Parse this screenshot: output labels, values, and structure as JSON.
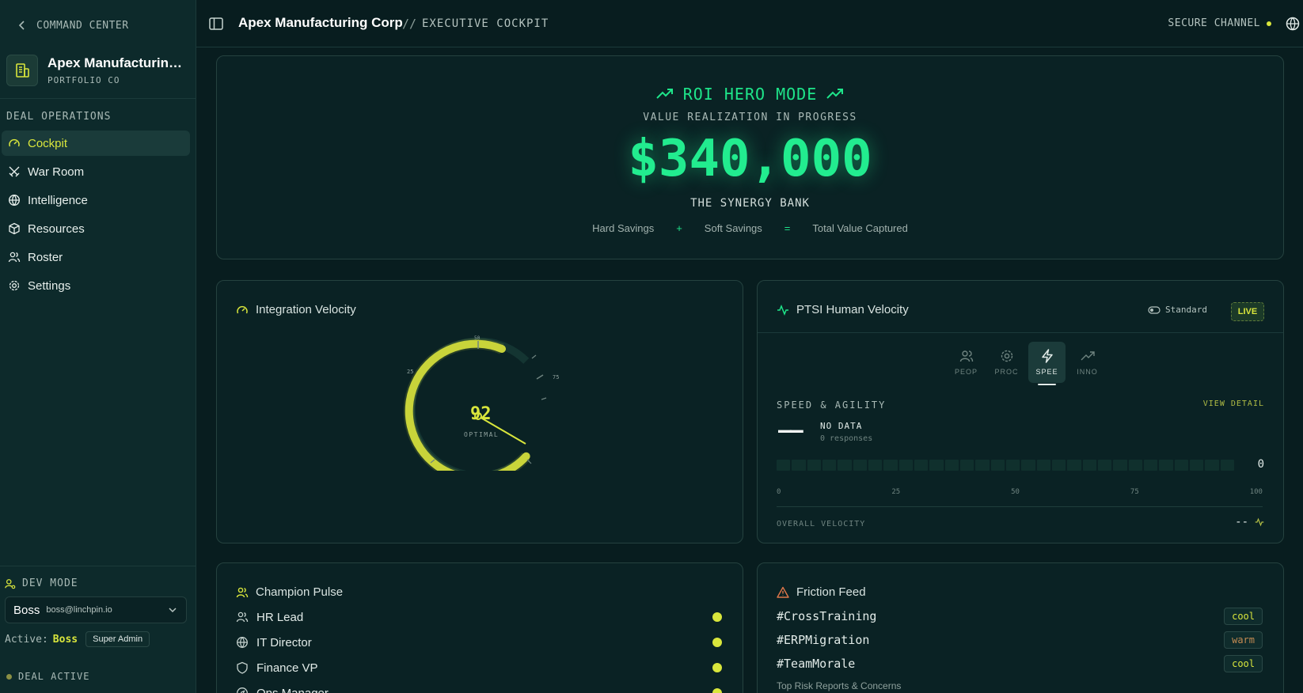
{
  "sidebar": {
    "back_label": "COMMAND CENTER",
    "company": {
      "name": "Apex Manufacturing ...",
      "subtitle": "PORTFOLIO CO"
    },
    "section_label": "DEAL OPERATIONS",
    "items": [
      {
        "label": "Cockpit",
        "icon": "gauge-icon",
        "active": true
      },
      {
        "label": "War Room",
        "icon": "swords-icon"
      },
      {
        "label": "Intelligence",
        "icon": "globe-icon"
      },
      {
        "label": "Resources",
        "icon": "package-icon"
      },
      {
        "label": "Roster",
        "icon": "users-icon"
      },
      {
        "label": "Settings",
        "icon": "gear-icon"
      }
    ],
    "dev_mode": {
      "label": "DEV MODE",
      "user_name": "Boss",
      "user_email": "boss@linchpin.io",
      "active_prefix": "Active:",
      "active_name": "Boss",
      "role": "Super Admin"
    },
    "deal_status": "DEAL ACTIVE"
  },
  "header": {
    "company": "Apex Manufacturing Corp",
    "separator": "//",
    "section": "EXECUTIVE COCKPIT",
    "secure_label": "SECURE CHANNEL"
  },
  "hero": {
    "title": "ROI HERO MODE",
    "subtitle": "VALUE REALIZATION IN PROGRESS",
    "value": "$340,000",
    "label": "THE SYNERGY BANK",
    "equation": [
      "Hard Savings",
      "+",
      "Soft Savings",
      "=",
      "Total Value Captured"
    ]
  },
  "integration_velocity": {
    "title": "Integration Velocity",
    "value": "92",
    "status": "OPTIMAL",
    "ticks": [
      "25",
      "50",
      "75"
    ],
    "percent": 92
  },
  "ptsi": {
    "title": "PTSI Human Velocity",
    "mode": "Standard",
    "live": "LIVE",
    "tabs": [
      {
        "label": "PEOP",
        "icon": "users-icon"
      },
      {
        "label": "PROC",
        "icon": "gear-icon"
      },
      {
        "label": "SPEE",
        "icon": "lightning-icon",
        "active": true
      },
      {
        "label": "INNO",
        "icon": "trend-up-icon"
      }
    ],
    "section_title": "SPEED & AGILITY",
    "view_detail": "VIEW DETAIL",
    "score": "——",
    "no_data": "NO DATA",
    "responses": "0 responses",
    "bar_value": "0",
    "axis": [
      "0",
      "25",
      "50",
      "75",
      "100"
    ],
    "overall_label": "OVERALL VELOCITY",
    "overall_value": "--"
  },
  "champion_pulse": {
    "title": "Champion Pulse",
    "rows": [
      {
        "label": "HR Lead",
        "icon": "users-icon"
      },
      {
        "label": "IT Director",
        "icon": "globe-icon"
      },
      {
        "label": "Finance VP",
        "icon": "shield-icon"
      },
      {
        "label": "Ops Manager",
        "icon": "compass-icon"
      }
    ]
  },
  "friction_feed": {
    "title": "Friction Feed",
    "rows": [
      {
        "tag": "#CrossTraining",
        "level": "cool"
      },
      {
        "tag": "#ERPMigration",
        "level": "warm"
      },
      {
        "tag": "#TeamMorale",
        "level": "cool"
      }
    ],
    "footer": "Top Risk Reports & Concerns"
  },
  "colors": {
    "accent_yellow": "#d9e63c",
    "accent_green": "#22ec8f",
    "background": "#081d1f",
    "warm": "#c38a52"
  }
}
